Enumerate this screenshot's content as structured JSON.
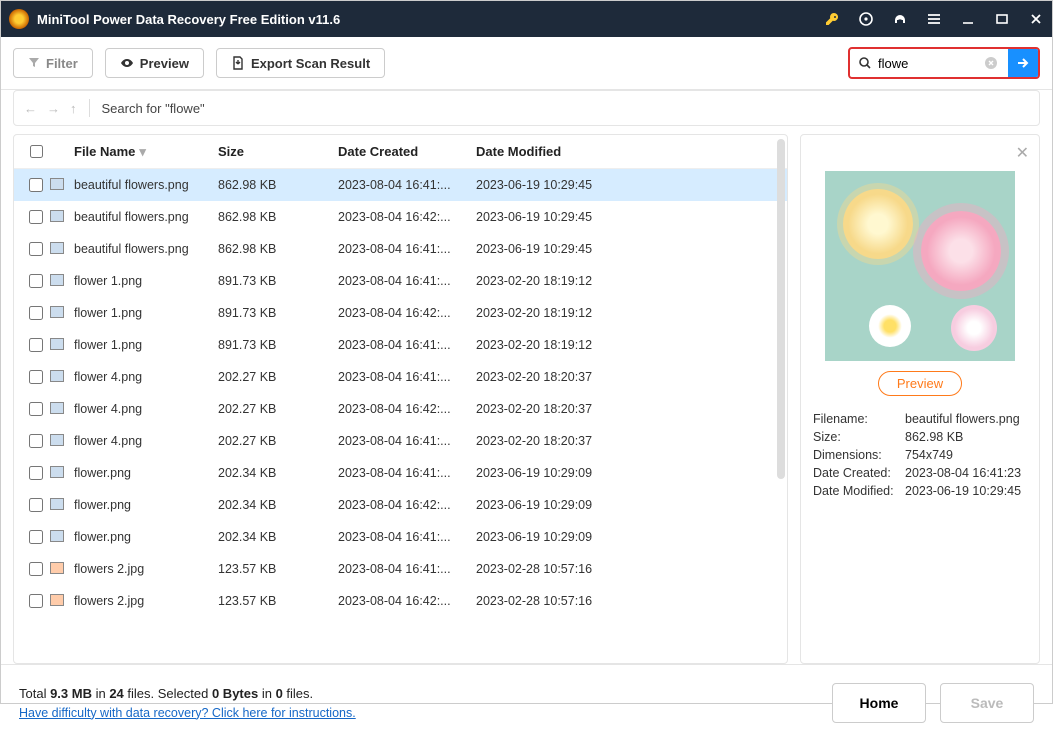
{
  "titlebar": {
    "title": "MiniTool Power Data Recovery Free Edition v11.6"
  },
  "toolbar": {
    "filter": "Filter",
    "preview": "Preview",
    "export": "Export Scan Result",
    "search_value": "flowe"
  },
  "breadcrumb": {
    "text": "Search for  \"flowe\""
  },
  "columns": {
    "name": "File Name",
    "size": "Size",
    "created": "Date Created",
    "modified": "Date Modified"
  },
  "rows": [
    {
      "name": "beautiful flowers.png",
      "size": "862.98 KB",
      "created": "2023-08-04 16:41:...",
      "modified": "2023-06-19 10:29:45",
      "selected": true,
      "type": "png"
    },
    {
      "name": "beautiful flowers.png",
      "size": "862.98 KB",
      "created": "2023-08-04 16:42:...",
      "modified": "2023-06-19 10:29:45",
      "type": "png"
    },
    {
      "name": "beautiful flowers.png",
      "size": "862.98 KB",
      "created": "2023-08-04 16:41:...",
      "modified": "2023-06-19 10:29:45",
      "type": "png"
    },
    {
      "name": "flower 1.png",
      "size": "891.73 KB",
      "created": "2023-08-04 16:41:...",
      "modified": "2023-02-20 18:19:12",
      "type": "png"
    },
    {
      "name": "flower 1.png",
      "size": "891.73 KB",
      "created": "2023-08-04 16:42:...",
      "modified": "2023-02-20 18:19:12",
      "type": "png"
    },
    {
      "name": "flower 1.png",
      "size": "891.73 KB",
      "created": "2023-08-04 16:41:...",
      "modified": "2023-02-20 18:19:12",
      "type": "png"
    },
    {
      "name": "flower 4.png",
      "size": "202.27 KB",
      "created": "2023-08-04 16:41:...",
      "modified": "2023-02-20 18:20:37",
      "type": "png"
    },
    {
      "name": "flower 4.png",
      "size": "202.27 KB",
      "created": "2023-08-04 16:42:...",
      "modified": "2023-02-20 18:20:37",
      "type": "png"
    },
    {
      "name": "flower 4.png",
      "size": "202.27 KB",
      "created": "2023-08-04 16:41:...",
      "modified": "2023-02-20 18:20:37",
      "type": "png"
    },
    {
      "name": "flower.png",
      "size": "202.34 KB",
      "created": "2023-08-04 16:41:...",
      "modified": "2023-06-19 10:29:09",
      "type": "png"
    },
    {
      "name": "flower.png",
      "size": "202.34 KB",
      "created": "2023-08-04 16:42:...",
      "modified": "2023-06-19 10:29:09",
      "type": "png"
    },
    {
      "name": "flower.png",
      "size": "202.34 KB",
      "created": "2023-08-04 16:41:...",
      "modified": "2023-06-19 10:29:09",
      "type": "png"
    },
    {
      "name": "flowers 2.jpg",
      "size": "123.57 KB",
      "created": "2023-08-04 16:41:...",
      "modified": "2023-02-28 10:57:16",
      "type": "jpg"
    },
    {
      "name": "flowers 2.jpg",
      "size": "123.57 KB",
      "created": "2023-08-04 16:42:...",
      "modified": "2023-02-28 10:57:16",
      "type": "jpg"
    }
  ],
  "preview": {
    "button": "Preview",
    "meta": {
      "filename_k": "Filename:",
      "filename_v": "beautiful flowers.png",
      "size_k": "Size:",
      "size_v": "862.98 KB",
      "dim_k": "Dimensions:",
      "dim_v": "754x749",
      "created_k": "Date Created:",
      "created_v": "2023-08-04 16:41:23",
      "modified_k": "Date Modified:",
      "modified_v": "2023-06-19 10:29:45"
    }
  },
  "footer": {
    "summary_prefix": "Total ",
    "total_size": "9.3 MB",
    "in1": " in ",
    "total_files": "24",
    "files_word": " files.  ",
    "selected_word": "Selected ",
    "sel_bytes": "0 Bytes",
    "in2": " in ",
    "sel_files": "0",
    "files2": " files.",
    "help": "Have difficulty with data recovery? Click here for instructions.",
    "home": "Home",
    "save": "Save"
  }
}
